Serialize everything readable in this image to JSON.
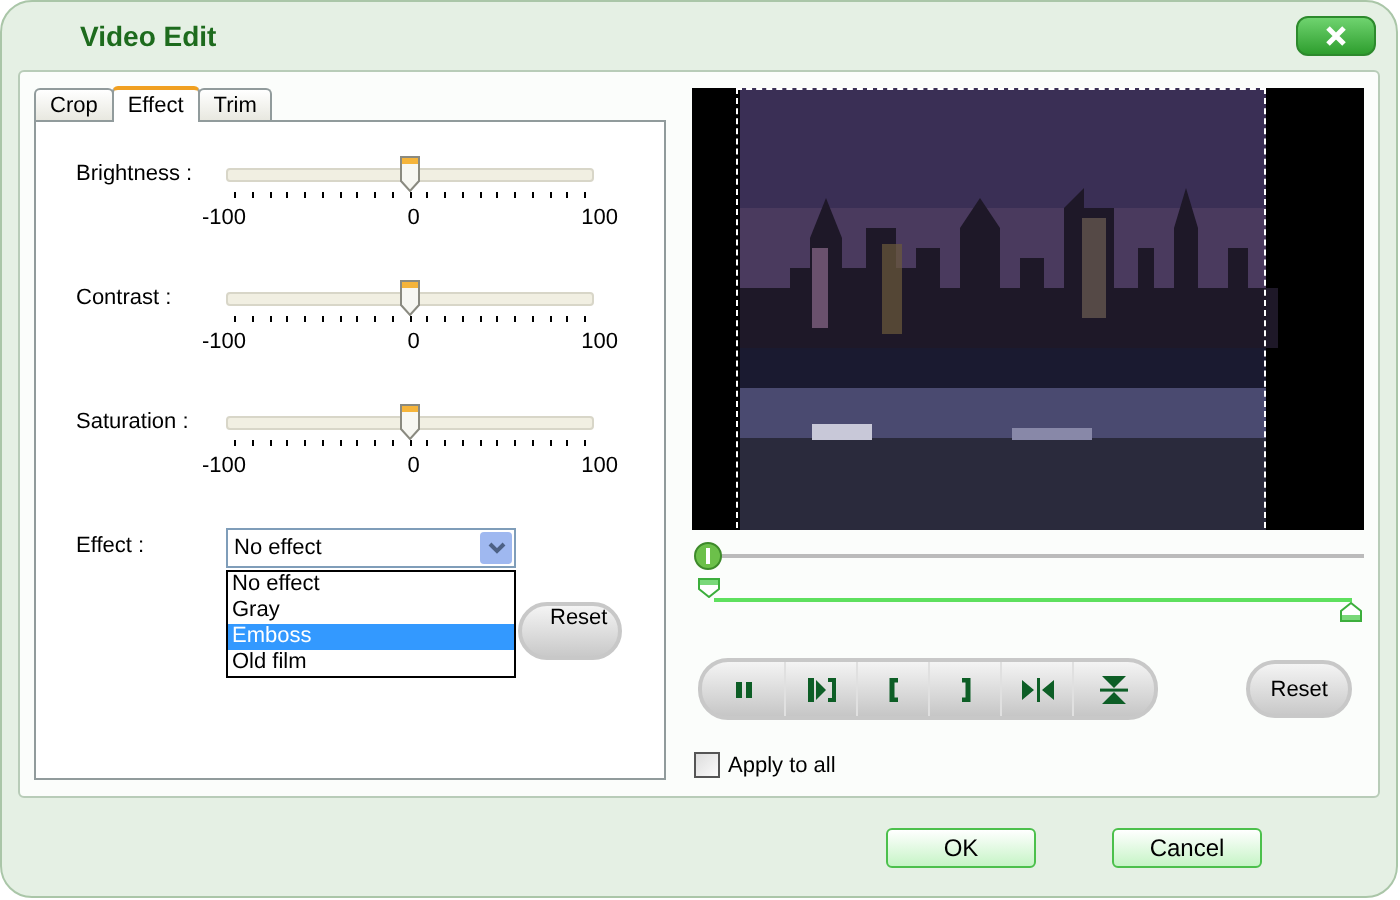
{
  "window": {
    "title": "Video Edit"
  },
  "tabs": [
    {
      "label": "Crop",
      "selected": false
    },
    {
      "label": "Effect",
      "selected": true
    },
    {
      "label": "Trim",
      "selected": false
    }
  ],
  "sliders": [
    {
      "label": "Brightness :",
      "level": 0.5,
      "min": "-100",
      "mid": "0",
      "max": "100"
    },
    {
      "label": "Contrast :",
      "level": 0.5,
      "min": "-100",
      "mid": "0",
      "max": "100"
    },
    {
      "label": "Saturation :",
      "level": 0.5,
      "min": "-100",
      "mid": "0",
      "max": "100"
    }
  ],
  "effect": {
    "label": "Effect :",
    "value": "No effect",
    "expanded": true,
    "options": [
      {
        "label": "No effect",
        "highlighted": false
      },
      {
        "label": "Gray",
        "highlighted": false
      },
      {
        "label": "Emboss",
        "highlighted": true
      },
      {
        "label": "Old film",
        "highlighted": false
      }
    ]
  },
  "effect_reset": "Reset",
  "preview": {
    "kind": "picture"
  },
  "position_slider": {
    "level": 0
  },
  "trim_range": {
    "handles": [
      {
        "level": 0
      },
      {
        "level": 1
      }
    ]
  },
  "transport": [
    {
      "kind": "pause"
    },
    {
      "kind": "frame"
    },
    {
      "kind": "mark-in"
    },
    {
      "kind": "mark-out"
    },
    {
      "kind": "join"
    },
    {
      "kind": "split"
    }
  ],
  "preview_reset": "Reset",
  "apply_to_all": {
    "label": "Apply to all",
    "checked": false
  },
  "buttons": [
    "OK",
    "Cancel"
  ]
}
